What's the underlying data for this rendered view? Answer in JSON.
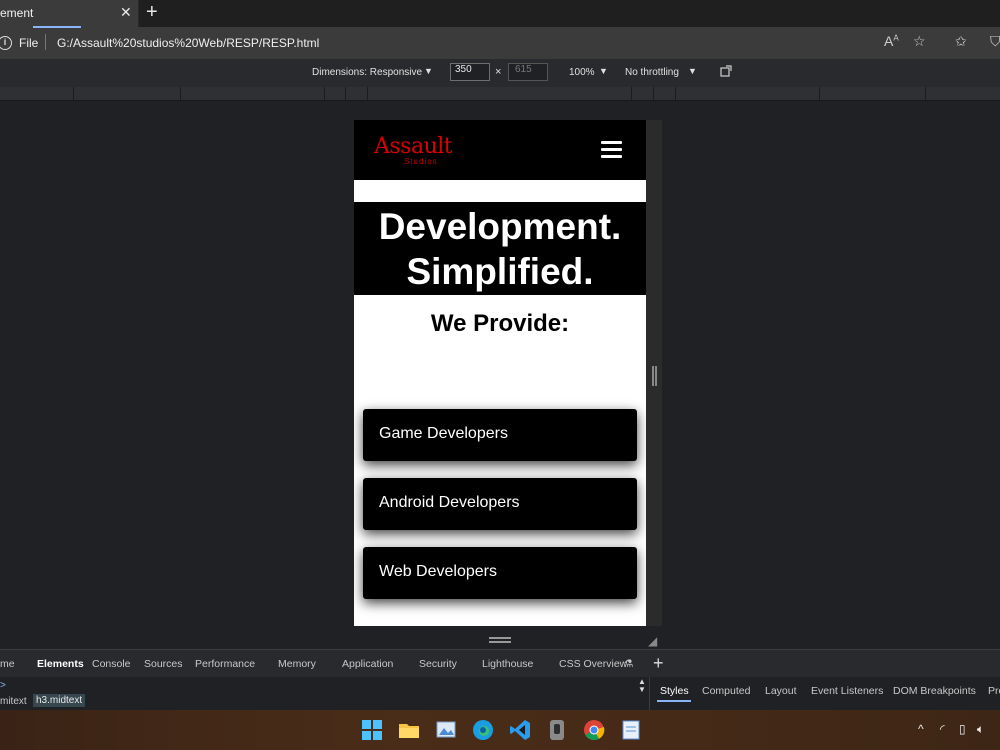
{
  "browser": {
    "tab_title": "ement",
    "url_scheme": "File",
    "url": "G:/Assault%20studios%20Web/RESP/RESP.html"
  },
  "device_toolbar": {
    "dimensions_label": "Dimensions: Responsive",
    "width": "350",
    "times": "×",
    "height": "615",
    "zoom": "100%",
    "throttling": "No throttling"
  },
  "site": {
    "logo_main": "Assault",
    "logo_sub": "Studios",
    "hero_line1": "Development.",
    "hero_line2": "Simplified.",
    "provide_heading": "We Provide:",
    "services": [
      "Game Developers",
      "Android Developers",
      "Web Developers"
    ]
  },
  "devtools": {
    "tabs": [
      "me",
      "Elements",
      "Console",
      "Sources",
      "Performance",
      "Memory",
      "Application",
      "Security",
      "Lighthouse",
      "CSS Overview"
    ],
    "active_tab": "Elements",
    "breadcrumbs": [
      "mitext",
      "h3.midtext"
    ],
    "styles_tabs": [
      "Styles",
      "Computed",
      "Layout",
      "Event Listeners",
      "DOM Breakpoints",
      "Pro"
    ]
  },
  "colors": {
    "logo_red": "#d90000",
    "active_tab_underline": "#8ab4f8"
  }
}
